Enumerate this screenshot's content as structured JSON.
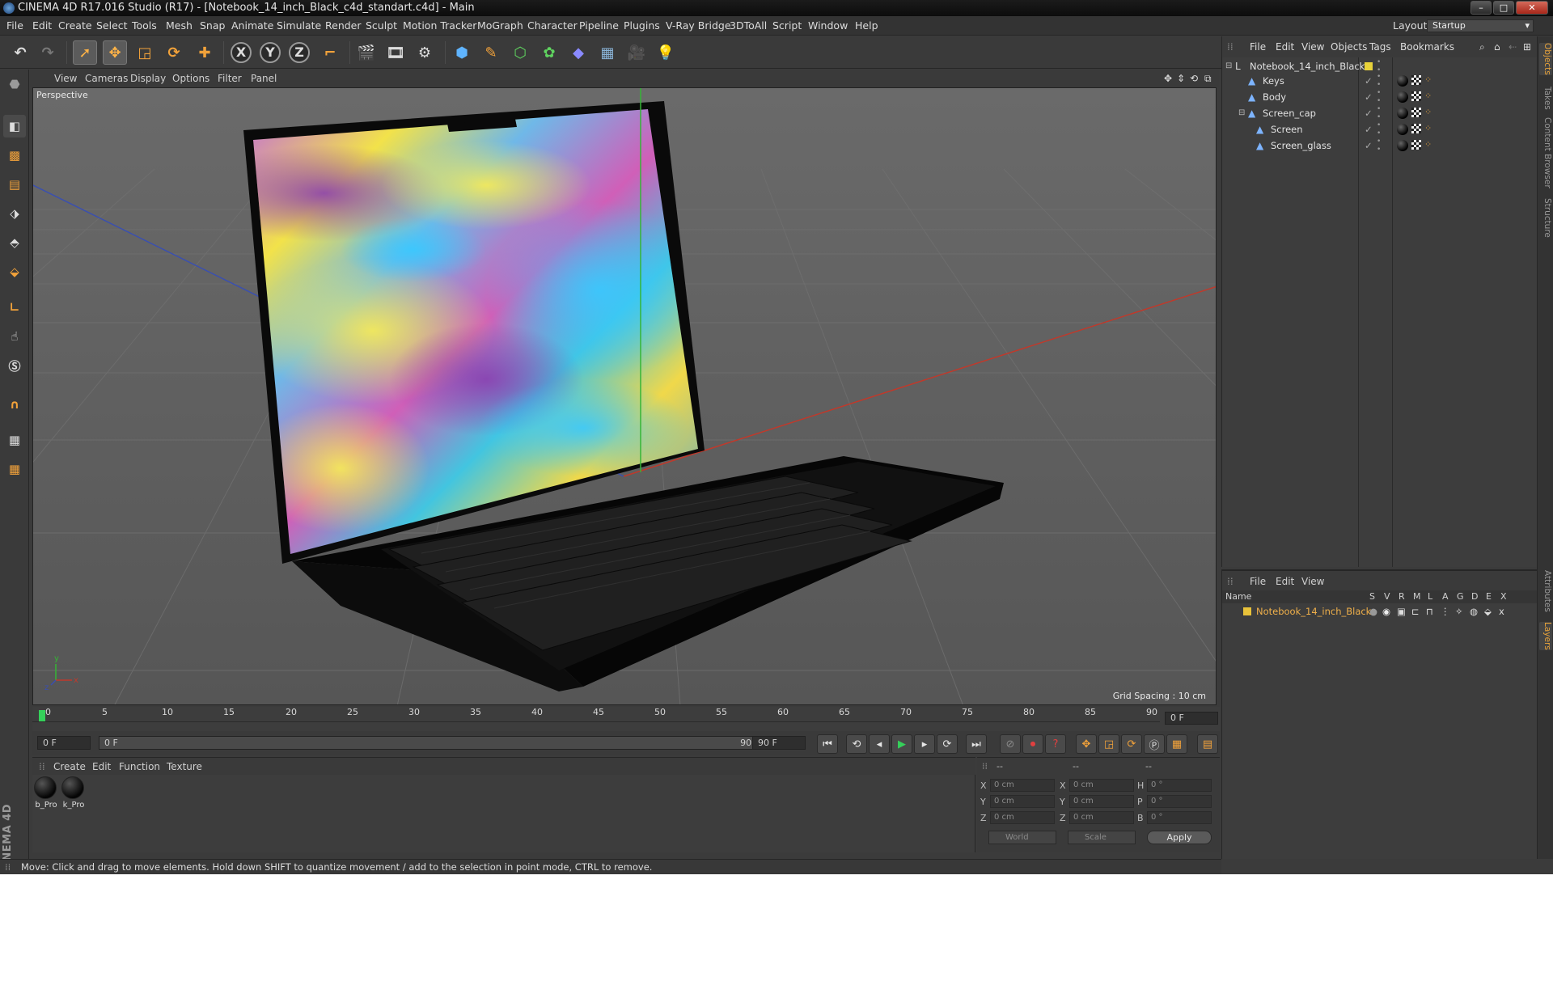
{
  "window": {
    "title": "CINEMA 4D R17.016 Studio (R17) - [Notebook_14_inch_Black_c4d_standart.c4d] - Main",
    "controls": [
      "–",
      "□",
      "✕"
    ]
  },
  "menubar": {
    "items": [
      "File",
      "Edit",
      "Create",
      "Select",
      "Tools",
      "Mesh",
      "Snap",
      "Animate",
      "Simulate",
      "Render",
      "Sculpt",
      "Motion Tracker",
      "MoGraph",
      "Character",
      "Pipeline",
      "Plugins",
      "V-Ray Bridge",
      "3DToAll",
      "Script",
      "Window",
      "Help"
    ],
    "layout_label": "Layout:",
    "layout_value": "Startup"
  },
  "toolbar": {
    "icons": [
      "undo-icon",
      "redo-icon",
      "live-selection-icon",
      "move-icon",
      "scale-icon",
      "rotate-icon",
      "recent-tool-icon",
      "x-axis-icon",
      "y-axis-icon",
      "z-axis-icon",
      "coordinate-system-icon",
      "render-view-icon",
      "render-picture-viewer-icon",
      "edit-render-settings-icon",
      "cube-icon",
      "pen-spline-icon",
      "subdivision-icon",
      "array-icon",
      "deformer-icon",
      "floor-icon",
      "camera-icon",
      "light-icon"
    ],
    "axis_labels": [
      "X",
      "Y",
      "Z"
    ]
  },
  "viewport": {
    "menu": [
      "View",
      "Cameras",
      "Display",
      "Options",
      "Filter",
      "Panel"
    ],
    "camera_label": "Perspective",
    "grid_spacing": "Grid Spacing : 10 cm",
    "axis_labels": {
      "y": "y",
      "x": "x",
      "z": "z"
    }
  },
  "timeline": {
    "ticks": [
      "0",
      "5",
      "10",
      "15",
      "20",
      "25",
      "30",
      "35",
      "40",
      "45",
      "50",
      "55",
      "60",
      "65",
      "70",
      "75",
      "80",
      "85",
      "90"
    ],
    "current_frame_field": "0 F",
    "start_field": "0 F",
    "range_start": "0 F",
    "range_end": "90 F",
    "end_field": "90 F"
  },
  "material_manager": {
    "menu": [
      "Create",
      "Edit",
      "Function",
      "Texture"
    ],
    "materials": [
      {
        "label": "b_Pro"
      },
      {
        "label": "k_Pro"
      }
    ]
  },
  "coordinates": {
    "header": [
      "--",
      "--",
      "--"
    ],
    "rows": [
      {
        "pos_label": "X",
        "pos": "0 cm",
        "size_label": "X",
        "size": "0 cm",
        "rot_label": "H",
        "rot": "0 °"
      },
      {
        "pos_label": "Y",
        "pos": "0 cm",
        "size_label": "Y",
        "size": "0 cm",
        "rot_label": "P",
        "rot": "0 °"
      },
      {
        "pos_label": "Z",
        "pos": "0 cm",
        "size_label": "Z",
        "size": "0 cm",
        "rot_label": "B",
        "rot": "0 °"
      }
    ],
    "mode_dropdown": "World",
    "size_dropdown": "Scale",
    "apply_label": "Apply"
  },
  "status": {
    "text": "Move: Click and drag to move elements. Hold down SHIFT to quantize movement / add to the selection in point mode, CTRL to remove."
  },
  "object_manager": {
    "menu": [
      "File",
      "Edit",
      "View",
      "Objects",
      "Tags",
      "Bookmarks"
    ],
    "objects": [
      {
        "name": "Notebook_14_inch_Black",
        "depth": 0,
        "type": "null"
      },
      {
        "name": "Keys",
        "depth": 1,
        "type": "polygon"
      },
      {
        "name": "Body",
        "depth": 1,
        "type": "polygon"
      },
      {
        "name": "Screen_cap",
        "depth": 1,
        "type": "polygon"
      },
      {
        "name": "Screen",
        "depth": 2,
        "type": "polygon"
      },
      {
        "name": "Screen_glass",
        "depth": 2,
        "type": "polygon"
      }
    ]
  },
  "layer_manager": {
    "menu": [
      "File",
      "Edit",
      "View"
    ],
    "columns": [
      "Name",
      "S",
      "V",
      "R",
      "M",
      "L",
      "A",
      "G",
      "D",
      "E",
      "X"
    ],
    "layers": [
      {
        "name": "Notebook_14_inch_Black",
        "color": "#e8c23a"
      }
    ]
  },
  "side_tabs": [
    "Objects",
    "Takes",
    "Content Browser",
    "Structure",
    "Attributes",
    "Layers"
  ],
  "colors": {
    "accent": "#e8a33a",
    "layer_name": "#f0b04a",
    "x_axis": "#c0392b",
    "y_axis": "#35b535",
    "z_axis": "#3a4fb0"
  }
}
